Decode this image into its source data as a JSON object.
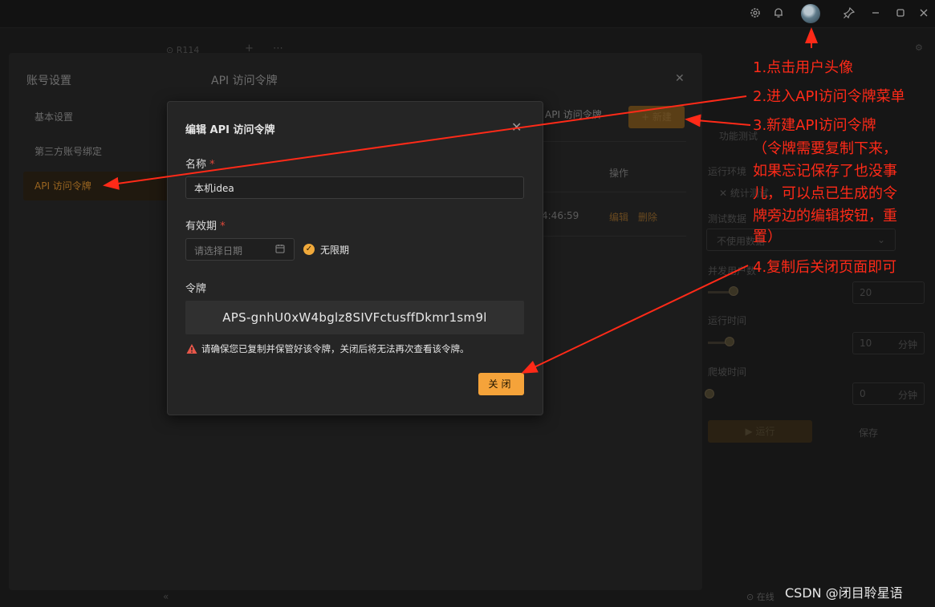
{
  "titlebar": {
    "icons": [
      "gear-icon",
      "bell-icon",
      "avatar",
      "pin-icon",
      "minimize-icon",
      "maximize-icon",
      "close-icon"
    ]
  },
  "background": {
    "tab_label": "R114",
    "status_label": "在线",
    "right_panel": {
      "section_title": "功能测试",
      "env_label": "运行环境",
      "env_value": "统计测试",
      "data_label": "测试数据",
      "data_value": "不使用数据",
      "users_label": "并发用户数",
      "users_value": "20",
      "duration_label": "运行时间",
      "duration_value": "10",
      "duration_unit": "分钟",
      "ramp_label": "爬坡时间",
      "ramp_value": "0",
      "ramp_unit": "分钟",
      "run_label": "▶ 运行",
      "save_label": "保存"
    }
  },
  "account_panel": {
    "title": "账号设置",
    "sidebar": [
      {
        "label": "基本设置"
      },
      {
        "label": "第三方账号绑定"
      },
      {
        "label": "API 访问令牌"
      }
    ],
    "section_title": "API 访问令牌",
    "tab_label": "API 访问令牌",
    "new_button": "+ 新建",
    "table": {
      "col_op": "操作",
      "row_time": "4:46:59",
      "edit": "编辑",
      "delete": "删除"
    }
  },
  "modal": {
    "title": "编辑 API 访问令牌",
    "name_label": "名称",
    "name_value": "本机idea",
    "expiry_label": "有效期",
    "date_placeholder": "请选择日期",
    "unlimited_label": "无限期",
    "unlimited_checked": true,
    "token_label": "令牌",
    "token_value": "APS-gnhU0xW4bglz8SIVFctusffDkmr1sm9l",
    "warning": "请确保您已复制并保管好该令牌，关闭后将无法再次查看该令牌。",
    "close_button": "关闭",
    "required_mark": "*"
  },
  "annotations": {
    "step1": "1.点击用户头像",
    "step2": "2.进入API访问令牌菜单",
    "step3": "3.新建API访问令牌",
    "step3_note_1": "（令牌需要复制下来，",
    "step3_note_2": "如果忘记保存了也没事",
    "step3_note_3": "儿，可以点已生成的令",
    "step3_note_4": "牌旁边的编辑按钮，重",
    "step3_note_5": "置）",
    "step4": "4.复制后关闭页面即可",
    "color": "#ff2a18"
  },
  "watermark": "CSDN @闭目聆星语"
}
